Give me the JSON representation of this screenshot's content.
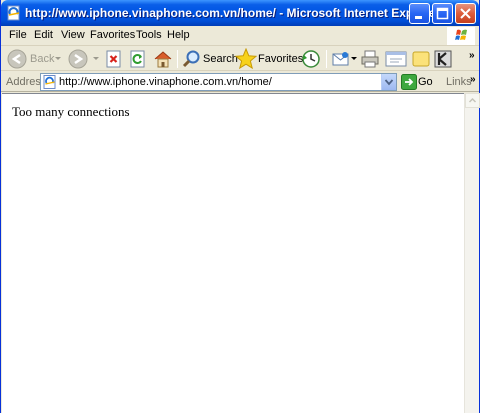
{
  "window": {
    "title": "http://www.iphone.vinaphone.com.vn/home/ - Microsoft Internet Explorer"
  },
  "menu": [
    "File",
    "Edit",
    "View",
    "Favorites",
    "Tools",
    "Help"
  ],
  "toolbar": {
    "back_label": "Back",
    "search_label": "Search",
    "favorites_label": "Favorites"
  },
  "address": {
    "label": "Address",
    "url": "http://www.iphone.vinaphone.com.vn/home/",
    "go_label": "Go",
    "links_label": "Links"
  },
  "page": {
    "message": "Too many connections"
  },
  "colors": {
    "titlebar": "#0054e3",
    "chrome": "#ece9d8",
    "close": "#dc5c3b"
  },
  "icons": {
    "title": "ie-page-icon",
    "back": "back-arrow-icon",
    "forward": "forward-arrow-icon",
    "stop": "stop-icon",
    "refresh": "refresh-icon",
    "home": "home-icon",
    "search": "search-icon",
    "favorites": "star-icon",
    "history": "history-icon",
    "mail": "mail-icon",
    "print": "print-icon",
    "edit": "edit-icon",
    "folder": "folder-icon",
    "messenger": "messenger-icon"
  }
}
